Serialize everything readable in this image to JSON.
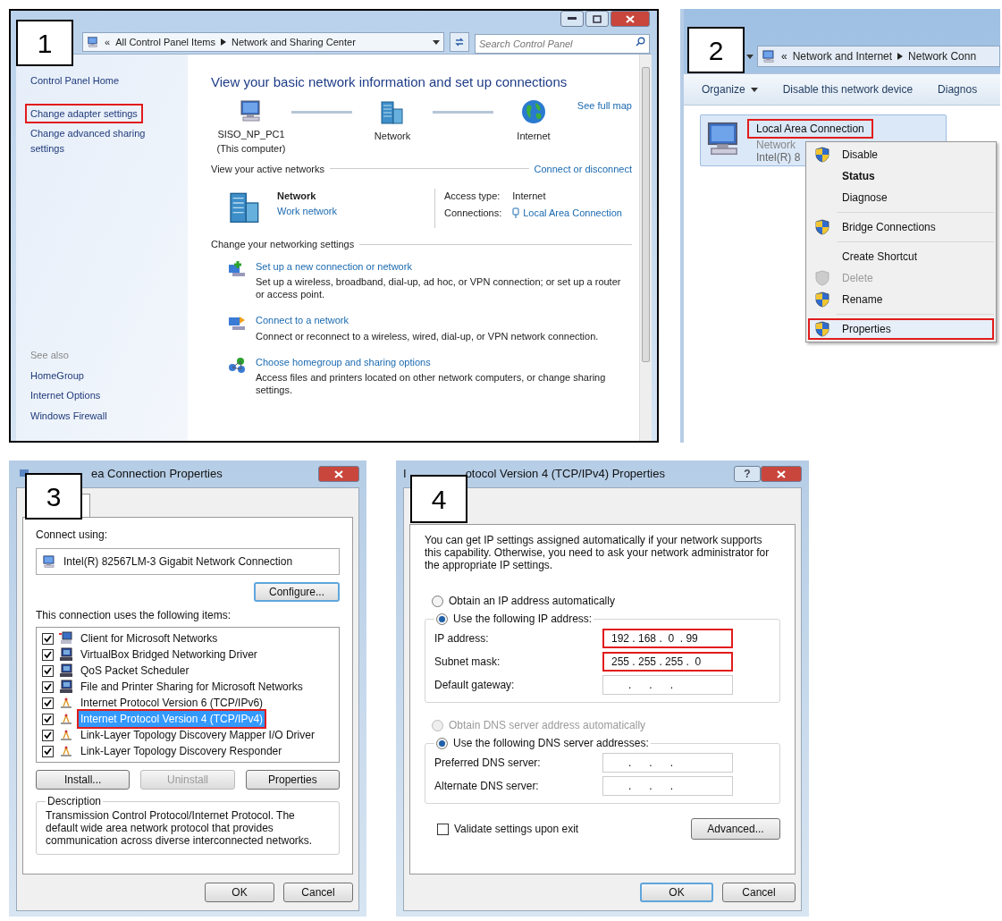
{
  "network_center": {
    "number": "1",
    "overflow_mark": "«",
    "breadcrumb": [
      "All Control Panel Items",
      "Network and Sharing Center"
    ],
    "search": {
      "placeholder": "Search Control Panel"
    },
    "sidebar": {
      "links": [
        {
          "label": "Control Panel Home",
          "highlighted": false
        },
        {
          "label": "Change adapter settings",
          "highlighted": true
        },
        {
          "label": "Change advanced sharing settings",
          "highlighted": false
        }
      ],
      "see_also_heading": "See also",
      "see_also": [
        "HomeGroup",
        "Internet Options",
        "Windows Firewall"
      ]
    },
    "heading": "View your basic network information and set up connections",
    "see_full_map": "See full map",
    "map_nodes": [
      {
        "kind": "computer",
        "label": "SISO_NP_PC1",
        "sublabel": "(This computer)"
      },
      {
        "kind": "network",
        "label": "Network"
      },
      {
        "kind": "internet",
        "label": "Internet"
      }
    ],
    "active_networks": {
      "heading": "View your active networks",
      "link": "Connect or disconnect",
      "name": "Network",
      "type": "Work network",
      "access_type_label": "Access type:",
      "access_type": "Internet",
      "connections_label": "Connections:",
      "connection": "Local Area Connection"
    },
    "settings": {
      "heading": "Change your networking settings",
      "tasks": [
        {
          "kind": "new",
          "title": "Set up a new connection or network",
          "description": "Set up a wireless, broadband, dial-up, ad hoc, or VPN connection; or set up a router or access point."
        },
        {
          "kind": "connect",
          "title": "Connect to a network",
          "description": "Connect or reconnect to a wireless, wired, dial-up, or VPN network connection."
        },
        {
          "kind": "homegroup",
          "title": "Choose homegroup and sharing options",
          "description": "Access files and printers located on other network computers, or change sharing settings."
        }
      ]
    }
  },
  "adapters_window": {
    "number": "2",
    "overflow_mark": "«",
    "breadcrumb": [
      "Network and Internet",
      "Network Conn"
    ],
    "toolbar": [
      {
        "label": "Organize",
        "dropdown": true
      },
      {
        "label": "Disable this network device",
        "dropdown": false
      },
      {
        "label": "Diagnos",
        "dropdown": false
      }
    ],
    "adapter": {
      "name": "Local Area Connection",
      "highlighted": true,
      "network": "Network",
      "device": "Intel(R) 8"
    },
    "context_menu": [
      {
        "kind": "item",
        "label": "Disable",
        "shield": true,
        "bold": false,
        "disabled": false,
        "highlighted": false
      },
      {
        "kind": "item",
        "label": "Status",
        "shield": false,
        "bold": true,
        "disabled": false,
        "highlighted": false
      },
      {
        "kind": "item",
        "label": "Diagnose",
        "shield": false,
        "bold": false,
        "disabled": false,
        "highlighted": false
      },
      {
        "kind": "separator"
      },
      {
        "kind": "item",
        "label": "Bridge Connections",
        "shield": true,
        "bold": false,
        "disabled": false,
        "highlighted": false
      },
      {
        "kind": "separator"
      },
      {
        "kind": "item",
        "label": "Create Shortcut",
        "shield": false,
        "bold": false,
        "disabled": false,
        "highlighted": false
      },
      {
        "kind": "item",
        "label": "Delete",
        "shield": true,
        "bold": false,
        "disabled": true,
        "highlighted": false
      },
      {
        "kind": "item",
        "label": "Rename",
        "shield": true,
        "bold": false,
        "disabled": false,
        "highlighted": false
      },
      {
        "kind": "separator"
      },
      {
        "kind": "item",
        "label": "Properties",
        "shield": true,
        "bold": false,
        "disabled": false,
        "highlighted": true
      }
    ]
  },
  "connection_properties": {
    "number": "3",
    "title": "ea Connection Properties",
    "connect_using_label": "Connect using:",
    "adapter": "Intel(R) 82567LM-3 Gigabit Network Connection",
    "configure": "Configure...",
    "items_label": "This connection uses the following items:",
    "items": [
      {
        "kind": "client",
        "label": "Client for Microsoft Networks",
        "checked": true,
        "selected": false
      },
      {
        "kind": "service",
        "label": "VirtualBox Bridged Networking Driver",
        "checked": true,
        "selected": false
      },
      {
        "kind": "service",
        "label": "QoS Packet Scheduler",
        "checked": true,
        "selected": false
      },
      {
        "kind": "service",
        "label": "File and Printer Sharing for Microsoft Networks",
        "checked": true,
        "selected": false
      },
      {
        "kind": "protocol",
        "label": "Internet Protocol Version 6 (TCP/IPv6)",
        "checked": true,
        "selected": false
      },
      {
        "kind": "protocol",
        "label": "Internet Protocol Version 4 (TCP/IPv4)",
        "checked": true,
        "selected": true
      },
      {
        "kind": "protocol",
        "label": "Link-Layer Topology Discovery Mapper I/O Driver",
        "checked": true,
        "selected": false
      },
      {
        "kind": "protocol",
        "label": "Link-Layer Topology Discovery Responder",
        "checked": true,
        "selected": false
      }
    ],
    "buttons": [
      {
        "label": "Install...",
        "disabled": false
      },
      {
        "label": "Uninstall",
        "disabled": true
      },
      {
        "label": "Properties",
        "disabled": false
      }
    ],
    "description_label": "Description",
    "description": "Transmission Control Protocol/Internet Protocol. The default wide area network protocol that provides communication across diverse interconnected networks.",
    "footer_buttons": [
      {
        "label": "OK",
        "default": false
      },
      {
        "label": "Cancel",
        "default": false
      }
    ]
  },
  "ipv4_properties": {
    "number": "4",
    "title_start": "I",
    "title": "otocol Version 4 (TCP/IPv4) Properties",
    "help": "?",
    "intro": "You can get IP settings assigned automatically if your network supports this capability. Otherwise, you need to ask your network administrator for the appropriate IP settings.",
    "ip_modes": [
      {
        "label": "Obtain an IP address automatically",
        "selected": false,
        "disabled": false
      },
      {
        "label": "Use the following IP address:",
        "selected": true,
        "disabled": false
      }
    ],
    "ip_fields": [
      {
        "label": "IP address:",
        "value": "192 . 168 .  0  . 99",
        "highlighted": true
      },
      {
        "label": "Subnet mask:",
        "value": "255 . 255 . 255 .  0",
        "highlighted": true
      },
      {
        "label": "Default gateway:",
        "value": "      .      .      .",
        "highlighted": false
      }
    ],
    "dns_modes": [
      {
        "label": "Obtain DNS server address automatically",
        "selected": false,
        "disabled": true
      },
      {
        "label": "Use the following DNS server addresses:",
        "selected": true,
        "disabled": false
      }
    ],
    "dns_fields": [
      {
        "label": "Preferred DNS server:",
        "value": "      .      .      .",
        "highlighted": false
      },
      {
        "label": "Alternate DNS server:",
        "value": "      .      .      .",
        "highlighted": false
      }
    ],
    "validate": {
      "label": "Validate settings upon exit",
      "checked": false
    },
    "advanced": "Advanced...",
    "footer_buttons": [
      {
        "label": "OK",
        "default": true
      },
      {
        "label": "Cancel",
        "default": false
      }
    ]
  }
}
